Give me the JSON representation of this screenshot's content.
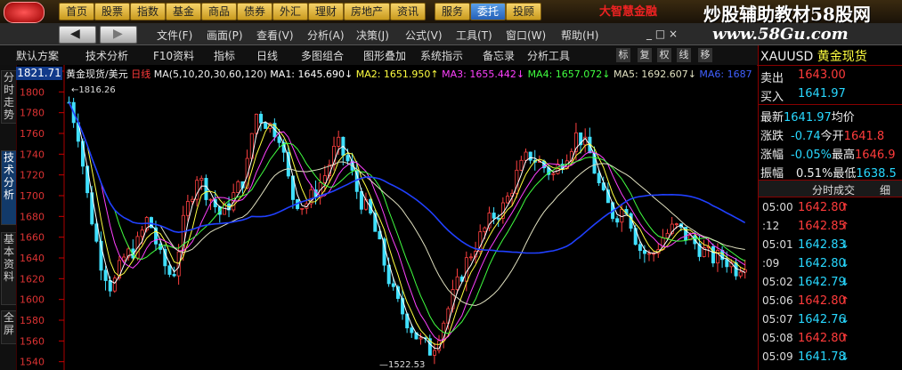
{
  "nav": {
    "items": [
      "首页",
      "股票",
      "指数",
      "基金",
      "商品",
      "债券",
      "外汇",
      "理财",
      "房地产",
      "资讯",
      "服务",
      "委托",
      "投顾"
    ],
    "active_index": 11,
    "logo_text": "大智慧金融",
    "watermark": "炒股辅助教材58股网",
    "watermark_url": "www.58Gu.com"
  },
  "menu": {
    "items": [
      "文件(F)",
      "画面(P)",
      "查看(V)",
      "分析(A)",
      "决策(J)",
      "公式(V)",
      "工具(T)",
      "窗口(W)",
      "帮助(H)"
    ]
  },
  "toolbar": {
    "items": [
      "默认方案",
      "技术分析",
      "F10资料",
      "指标",
      "日线",
      "多图组合",
      "图形叠加",
      "系统指示",
      "备忘录",
      "分析工具"
    ],
    "right_buttons": [
      "标",
      "复",
      "权",
      "线",
      "移"
    ]
  },
  "left_tabs": [
    {
      "label": "分时走势",
      "active": false
    },
    {
      "label": "技术分析",
      "active": true
    },
    {
      "label": "基本资料",
      "active": false
    },
    {
      "label": "全屏",
      "active": false
    }
  ],
  "chart_header": {
    "price_box": "1821.71",
    "symbol_name": "黄金现货/美元",
    "period": "日线",
    "ma_params": "MA(5,10,20,30,60,120)",
    "ma1": "MA1: 1645.690↓",
    "ma2": "MA2: 1651.950↑",
    "ma3": "MA3: 1655.442↓",
    "ma4": "MA4: 1657.072↓",
    "ma5": "MA5: 1692.607↓",
    "ma6": "MA6: 1687"
  },
  "chart_data": {
    "type": "candlestick",
    "y_ticks": [
      "1820",
      "1800",
      "1780",
      "1760",
      "1740",
      "1720",
      "1700",
      "1680",
      "1660",
      "1640",
      "1620",
      "1600",
      "1580",
      "1560",
      "1540"
    ],
    "ylim": [
      1532,
      1826
    ],
    "annotations": {
      "high": "1816.26",
      "low": "1522.53"
    },
    "ma_colors": {
      "ma5": "#ffffff",
      "ma10": "#ffff40",
      "ma20": "#ff40ff",
      "ma30": "#40ff40",
      "ma60": "#e0e0c0",
      "ma120": "#2040ff"
    }
  },
  "right": {
    "symbol": "XAUUSD",
    "name": "黄金现货",
    "sell_label": "卖出",
    "sell": "1643.00",
    "buy_label": "买入",
    "buy": "1641.97",
    "latest_label": "最新",
    "latest": "1641.97",
    "avg_label": "均价",
    "change_label": "涨跌",
    "change": "-0.74",
    "open_label": "今开",
    "open": "1641.8",
    "pct_label": "涨幅",
    "pct": "-0.05%",
    "high_label": "最高",
    "high": "1646.9",
    "amp_label": "振幅",
    "amp": "0.51%",
    "low_label": "最低",
    "low": "1638.5",
    "tab_label": "分时成交",
    "tab2_label": "细",
    "ticks": [
      {
        "time": "05:00",
        "price": "1642.80",
        "dir": "↑",
        "up": true
      },
      {
        "time": ":12",
        "price": "1642.85",
        "dir": "↑",
        "up": true
      },
      {
        "time": "05:01",
        "price": "1642.83",
        "dir": "↓",
        "up": false
      },
      {
        "time": ":09",
        "price": "1642.80",
        "dir": "↓",
        "up": false
      },
      {
        "time": "05:02",
        "price": "1642.79",
        "dir": "↓",
        "up": false
      },
      {
        "time": "05:06",
        "price": "1642.80",
        "dir": "↑",
        "up": true
      },
      {
        "time": "05:07",
        "price": "1642.76",
        "dir": "↓",
        "up": false
      },
      {
        "time": "05:08",
        "price": "1642.80",
        "dir": "↑",
        "up": true
      },
      {
        "time": "05:09",
        "price": "1641.78",
        "dir": "↓",
        "up": false
      }
    ]
  }
}
